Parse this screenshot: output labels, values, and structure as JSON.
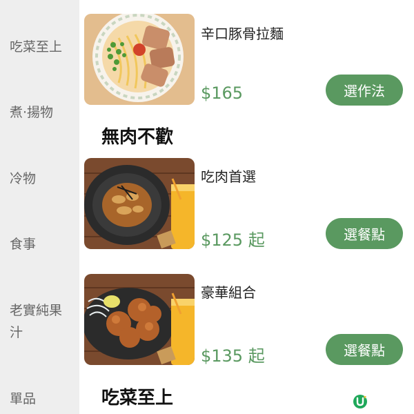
{
  "sidebar": {
    "items": [
      {
        "label": "吃菜至上"
      },
      {
        "label": "煮‧揚物"
      },
      {
        "label": "冷物"
      },
      {
        "label": "食事"
      },
      {
        "label": "老實純果汁"
      },
      {
        "label": "單品"
      }
    ]
  },
  "menu": {
    "dishes": [
      {
        "name": "辛口豚骨拉麵",
        "price": "$165",
        "button": "選作法",
        "image": "ramen-photo"
      },
      {
        "name": "吃肉首選",
        "price": "$125 起",
        "button": "選餐點",
        "image": "pork-bowl-juice-photo"
      },
      {
        "name": "豪華組合",
        "price": "$135 起",
        "button": "選餐點",
        "image": "fried-chicken-juice-photo"
      }
    ],
    "sections": [
      {
        "title": "無肉不歡"
      },
      {
        "title": "吃菜至上"
      }
    ]
  },
  "colors": {
    "accent": "#5a9960",
    "sidebar_bg": "#eeeeee",
    "sidebar_text": "#666666"
  },
  "icons": {
    "floating": "u-logo-icon"
  }
}
